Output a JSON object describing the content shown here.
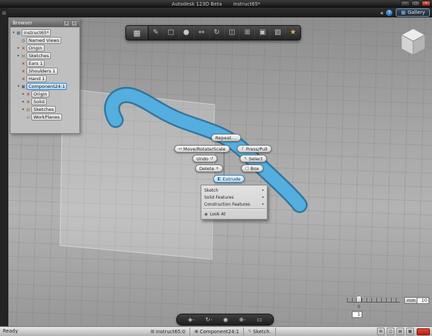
{
  "titlebar": {
    "app_title": "Autodesk 123D Beta",
    "doc_title": "instruct65*",
    "minimize": "–",
    "maximize": "▢",
    "close": "×"
  },
  "appbar": {
    "back": "◂",
    "help": "?",
    "gallery_icon": "▦",
    "gallery_label": "Gallery"
  },
  "side_strip": {
    "panel_icon": "⊞"
  },
  "browser": {
    "header": "Browser",
    "btn1": "⊞",
    "btn2": "⊟",
    "tree": [
      {
        "disc": "▾",
        "glyph": "▦",
        "label": "instruct65*"
      },
      {
        "disc": "",
        "glyph": "◎",
        "label": "Named Views"
      },
      {
        "disc": "▸",
        "glyph": "×",
        "label": "Origin"
      },
      {
        "disc": "▸",
        "glyph": "▤",
        "label": "Sketches"
      },
      {
        "disc": "",
        "glyph": "×",
        "label": "Ears 1"
      },
      {
        "disc": "",
        "glyph": "×",
        "label": "Shoulders 1"
      },
      {
        "disc": "",
        "glyph": "×",
        "label": "Hand 1"
      },
      {
        "disc": "▾",
        "glyph": "▣",
        "label": "Component24:1"
      },
      {
        "disc": "▸",
        "glyph": "×",
        "label": "Origin"
      },
      {
        "disc": "▸",
        "glyph": "×",
        "label": "Solid"
      },
      {
        "disc": "▸",
        "glyph": "▤",
        "label": "Sketches"
      },
      {
        "disc": "",
        "glyph": "▱",
        "label": "WorkPlanes"
      }
    ]
  },
  "toolbar": {
    "menu_glyph": "▦",
    "tools": [
      {
        "glyph": "✎"
      },
      {
        "glyph": "▢"
      },
      {
        "glyph": "●"
      },
      {
        "glyph": "↔"
      },
      {
        "glyph": "↻"
      },
      {
        "glyph": "◫"
      },
      {
        "glyph": "⊞"
      },
      {
        "glyph": "▣"
      },
      {
        "glyph": "▨"
      },
      {
        "glyph": "★"
      }
    ]
  },
  "context_menu": {
    "repeat": "Repeat....",
    "move": "Move/Rotate/Scale",
    "press_pull": "Press/Pull",
    "undo": "Undo",
    "select": "Select",
    "delete": "Delete",
    "box": "Box",
    "extrude": "Extrude",
    "arrow": "▸",
    "icons": {
      "move": "↔",
      "undo": "↺",
      "delete": "×",
      "press": "⇧",
      "select": "↖",
      "box": "▢",
      "extrude": "◧",
      "lookat": "◉"
    },
    "submenu": {
      "sketch": "Sketch",
      "solid_features": "Solid Features",
      "construction_features": "Construction Features",
      "look_at": "Look At"
    }
  },
  "navbar": {
    "dd": "▾",
    "icons": [
      {
        "glyph": "◈"
      },
      {
        "glyph": "↻"
      },
      {
        "glyph": "◉"
      },
      {
        "glyph": "⊕"
      },
      {
        "glyph": "▭"
      }
    ]
  },
  "scale_widget": {
    "origin": "0",
    "unit": "mm",
    "major": "10",
    "minor": "1"
  },
  "statusbar": {
    "ready": "Ready",
    "fields": [
      {
        "glyph": "▦",
        "label": "instruct65:0"
      },
      {
        "glyph": "▣",
        "label": "Component24:1"
      },
      {
        "glyph": "✎",
        "label": "Sketch."
      }
    ],
    "icons": [
      {
        "glyph": "⊞"
      },
      {
        "glyph": "◫"
      },
      {
        "glyph": "▤"
      },
      {
        "glyph": "▦"
      }
    ]
  }
}
